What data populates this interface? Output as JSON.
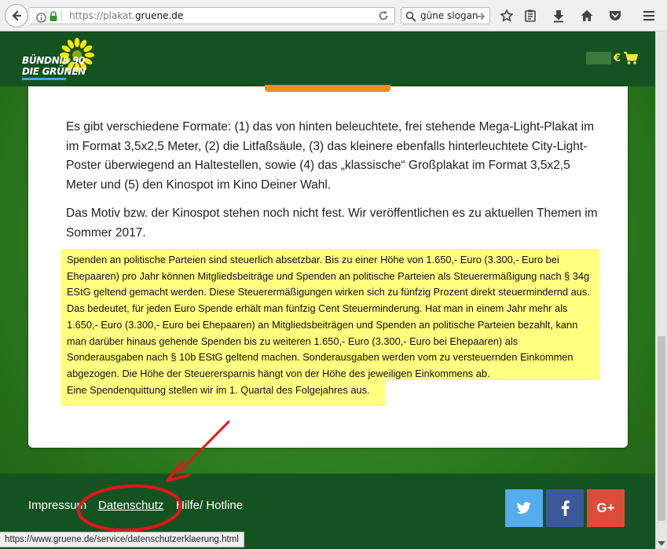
{
  "browser": {
    "url_prefix": "https://plakat.",
    "url_host": "gruene.de",
    "search_value": "güne slogan"
  },
  "header": {
    "logo_line1": "BÜNDNIS 90",
    "logo_line2": "DIE GRÜNEN",
    "cart_currency": "€"
  },
  "content": {
    "paragraph1": "Es gibt verschiedene Formate: (1) das von hinten beleuchtete, frei stehende Mega-Light-Plakat im im Format 3,5x2,5 Meter, (2) die Litfaßsäule, (3) das kleinere ebenfalls hinterleuchtete City-Light-Poster überwiegend an Haltestellen, sowie (4) das „klassische“ Großplakat im Format 3,5x2,5 Meter und (5) den Kinospot im Kino Deiner Wahl.",
    "paragraph2": "Das Motiv bzw. der Kinospot stehen noch nicht fest. Wir veröffentlichen es zu aktuellen Themen im Sommer 2017.",
    "highlight_text": "Spenden an politische Parteien sind steuerlich absetzbar. Bis zu einer Höhe von 1.650,- Euro (3.300,- Euro bei Ehepaaren) pro Jahr können Mitgliedsbeiträge und Spenden an politische Parteien als Steuerermäßigung nach § 34g EStG geltend gemacht werden. Diese Steuerermäßigungen wirken sich zu fünfzig Prozent direkt steuermindernd aus. Das bedeutet, für jeden Euro Spende erhält man fünfzig Cent Steuerminderung. Hat man in einem Jahr mehr als 1.650,- Euro (3.300,- Euro bei Ehepaaren) an Mitgliedsbeiträgen und Spenden an politische Parteien bezahlt, kann man darüber hinaus gehende Spenden bis zu weiteren 1.650,- Euro (3.300,- Euro bei Ehepaaren) als Sonderausgaben nach § 10b EStG geltend machen. Sonderausgaben werden vom zu versteuernden Einkommen abgezogen. Die Höhe der Steuerersparnis hängt von der Höhe des jeweiligen Einkommens ab.",
    "highlight_last": "Eine Spendenquittung stellen wir im 1. Quartal des Folgejahres aus."
  },
  "footer": {
    "links": [
      "Impressum",
      "Datenschutz",
      "Hilfe/ Hotline"
    ],
    "social_google": "G+"
  },
  "statusbar": {
    "hover_url": "https://www.gruene.de/service/datenschutzerklaerung.html"
  },
  "colors": {
    "header_green": "#145321",
    "highlight_yellow": "#ffff80",
    "annotation_red": "#e8141b",
    "twitter_blue": "#55acee",
    "facebook_blue": "#3b5998",
    "google_red": "#dd4b39",
    "sunflower_yellow": "#ffe600"
  }
}
